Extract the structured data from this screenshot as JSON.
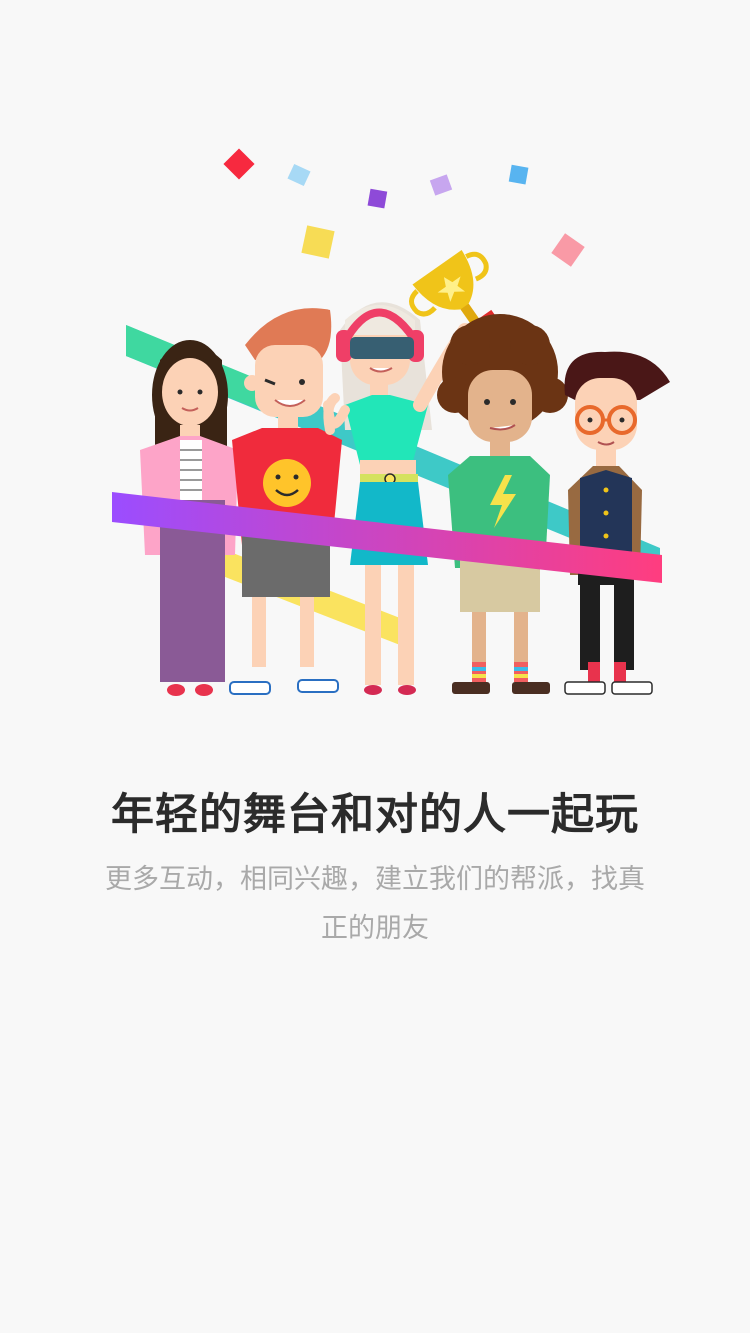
{
  "onboarding": {
    "title": "年轻的舞台和对的人一起玩",
    "subtitle": "更多互动，相同兴趣，建立我们的帮派，找真正的朋友"
  },
  "illustration": {
    "description_icon": "group-of-friends-celebrating-illustration",
    "colors": {
      "background": "#f8f8f8",
      "ribbon_start": "#9b4dff",
      "ribbon_end": "#ff3d7f",
      "text_primary": "#2b2b2b",
      "text_secondary": "#a9a9a9"
    }
  }
}
